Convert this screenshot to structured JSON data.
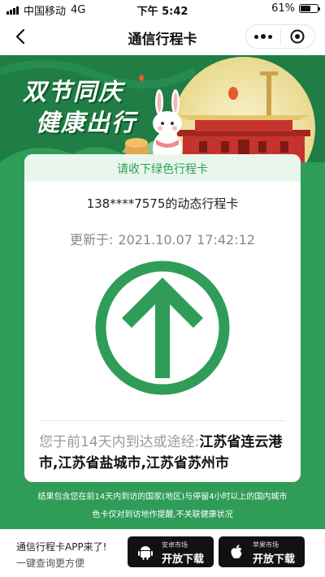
{
  "status_bar": {
    "carrier": "中国移动",
    "network": "4G",
    "time": "下午 5:42",
    "battery": "61%",
    "battery_level": 0.61
  },
  "nav": {
    "title": "通信行程卡"
  },
  "banner": {
    "line1": "双节同庆",
    "line2": "健康出行"
  },
  "card": {
    "header": "请收下绿色行程卡",
    "phone_line": "138****7575的动态行程卡",
    "updated_label": "更新于:",
    "updated_time": "2021.10.07 17:42:12",
    "route_label": "您于前14天内到达或途经:",
    "route_cities": "江苏省连云港市,江苏省盐城市,江苏省苏州市",
    "arrow_color": "#2f9d58"
  },
  "notes": {
    "line1": "结果包含您在前14天内到访的国家(地区)与停留4小时以上的国内城市",
    "line2": "色卡仅对到访地作提醒,不关联健康状况"
  },
  "bottom": {
    "promo_title": "通信行程卡APP来了!",
    "promo_sub": "一键查询更方便",
    "android": {
      "small": "安卓市场",
      "label": "开放下载"
    },
    "apple": {
      "small": "苹果市场",
      "label": "开放下载"
    }
  },
  "colors": {
    "primary_green": "#2f9d58",
    "banner_green": "#1f7d45",
    "text_gray": "#888888"
  }
}
